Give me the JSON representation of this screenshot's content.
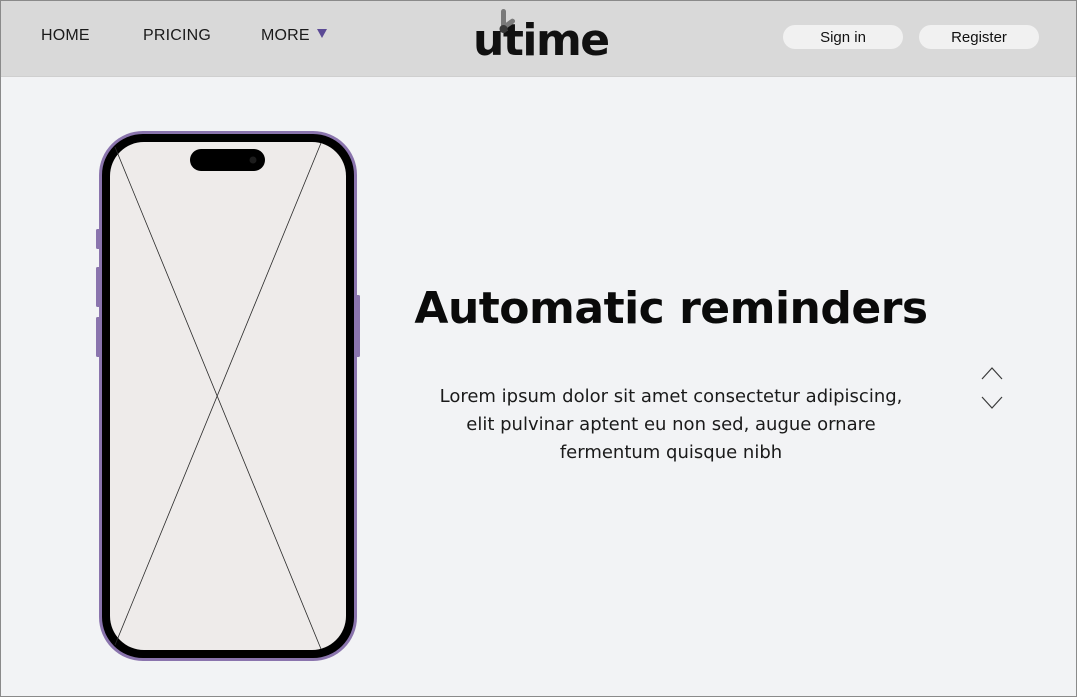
{
  "header": {
    "nav": [
      {
        "label": "HOME"
      },
      {
        "label": "PRICING"
      },
      {
        "label": "MORE"
      }
    ],
    "logo_text": "utime",
    "auth": {
      "signin_label": "Sign in",
      "register_label": "Register"
    }
  },
  "hero": {
    "title": "Automatic reminders",
    "body_lines": [
      "Lorem ipsum dolor sit amet consectetur adipiscing,",
      "elit pulvinar aptent eu non sed, augue ornare",
      "fermentum quisque nibh"
    ]
  },
  "icons": {
    "more_caret": "caret-down-icon",
    "scroll_up": "chevron-up-icon",
    "scroll_down": "chevron-down-icon",
    "phone_placeholder": "image-placeholder-icon"
  },
  "colors": {
    "header_bg": "#d9d9d9",
    "page_bg": "#f2f3f5",
    "accent": "#5b4a95",
    "phone_frame": "#8a74ad",
    "phone_screen": "#eeebea"
  }
}
